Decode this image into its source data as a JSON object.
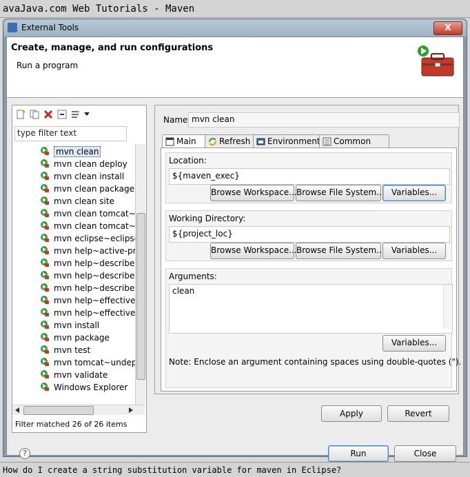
{
  "site_title": "avaJava.com Web Tutorials - Maven",
  "window": {
    "title": "External Tools",
    "close_label": "X"
  },
  "header": {
    "title": "Create, manage, and run configurations",
    "subtitle": "Run a program"
  },
  "left": {
    "filter_placeholder": "type filter text",
    "items": [
      "mvn clean",
      "mvn clean deploy",
      "mvn clean install",
      "mvn clean package",
      "mvn clean site",
      "mvn clean tomcat~u",
      "mvn clean tomcat~r",
      "mvn eclipse~eclipse",
      "mvn help~active-pr",
      "mvn help~describe",
      "mvn help~describe",
      "mvn help~describe",
      "mvn help~effective-",
      "mvn help~effective-",
      "mvn install",
      "mvn package",
      "mvn test",
      "mvn tomcat~undep",
      "mvn validate",
      "Windows Explorer"
    ],
    "filter_status": "Filter matched 26 of 26 items"
  },
  "right": {
    "name_label": "Name:",
    "name_value": "mvn clean",
    "tabs": [
      "Main",
      "Refresh",
      "Environment",
      "Common"
    ],
    "location": {
      "label": "Location:",
      "value": "${maven_exec}",
      "browse_workspace": "Browse Workspace...",
      "browse_fs": "Browse File System...",
      "variables": "Variables..."
    },
    "workdir": {
      "label": "Working Directory:",
      "value": "${project_loc}",
      "browse_workspace": "Browse Workspace...",
      "browse_fs": "Browse File System...",
      "variables": "Variables..."
    },
    "arguments": {
      "label": "Arguments:",
      "value": "clean",
      "variables": "Variables...",
      "note": "Note: Enclose an argument containing spaces using double-quotes (\")."
    },
    "apply": "Apply",
    "revert": "Revert"
  },
  "footer": {
    "help": "?",
    "run": "Run",
    "close": "Close"
  },
  "caption": "How do I create a string substitution variable for maven in Eclipse?"
}
